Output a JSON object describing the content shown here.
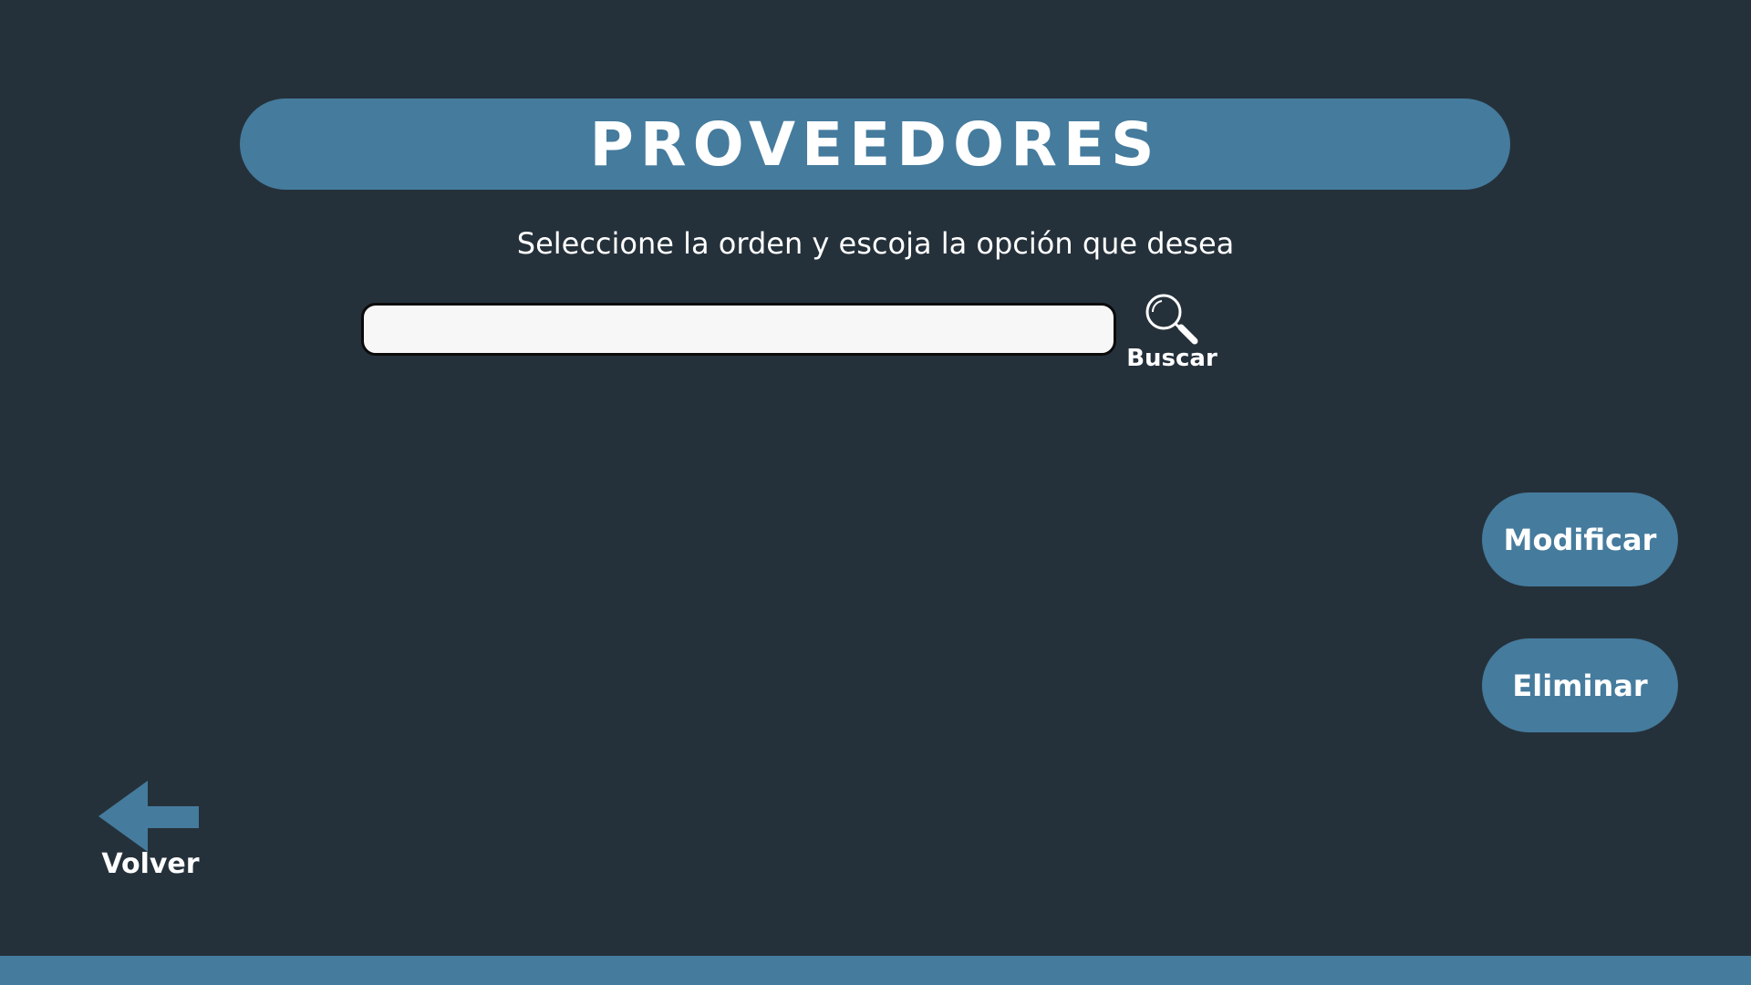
{
  "header": {
    "title": "PROVEEDORES"
  },
  "instructions": {
    "text": "Seleccione  la orden y escoja la opción que desea"
  },
  "search": {
    "value": "",
    "placeholder": "",
    "button_label": "Buscar",
    "icon": "magnifier-icon"
  },
  "actions": {
    "modify_label": "Modificar",
    "delete_label": "Eliminar"
  },
  "navigation": {
    "back_label": "Volver",
    "back_icon": "arrow-left-icon"
  },
  "colors": {
    "background": "#25313a",
    "accent": "#457b9d",
    "text": "#ffffff",
    "input_background": "#f7f7f7"
  }
}
